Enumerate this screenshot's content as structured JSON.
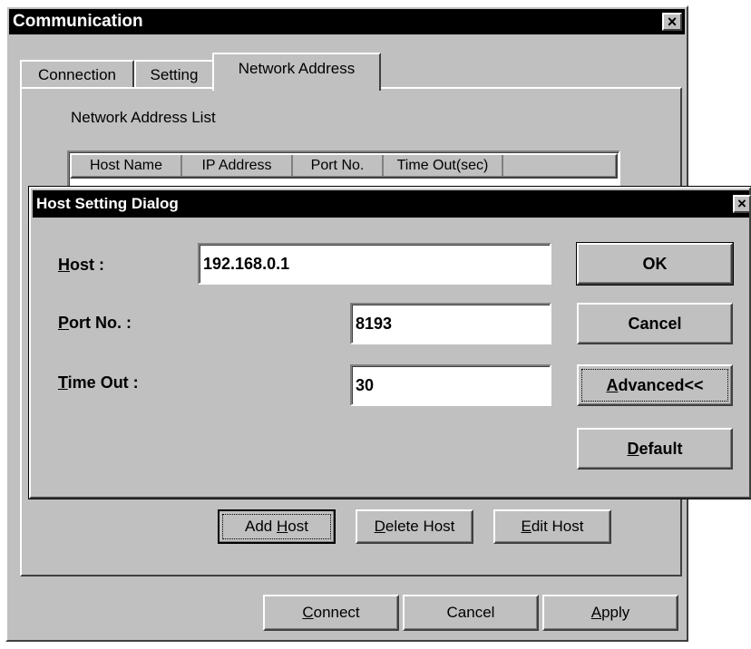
{
  "comm": {
    "title": "Communication",
    "close_glyph": "×",
    "tabs": [
      {
        "label": "Connection"
      },
      {
        "label": "Setting"
      },
      {
        "label": "Network Address"
      }
    ],
    "list_label": "Network Address List",
    "columns": [
      "Host Name",
      "IP Address",
      "Port No.",
      "Time Out(sec)"
    ],
    "add_host": {
      "pre": "Add ",
      "key": "H",
      "post": "ost"
    },
    "delete_host": {
      "pre": "",
      "key": "D",
      "post": "elete Host"
    },
    "edit_host": {
      "pre": "",
      "key": "E",
      "post": "dit Host"
    },
    "connect": {
      "pre": "",
      "key": "C",
      "post": "onnect"
    },
    "cancel": "Cancel",
    "apply": {
      "pre": "",
      "key": "A",
      "post": "pply"
    }
  },
  "host_dialog": {
    "title": "Host Setting Dialog",
    "close_glyph": "×",
    "host_label": {
      "key": "H",
      "post": "ost :"
    },
    "host_value": "192.168.0.1",
    "port_label": {
      "key": "P",
      "post": "ort No. :"
    },
    "port_value": "8193",
    "timeout_label": {
      "key": "T",
      "post": "ime Out :"
    },
    "timeout_value": "30",
    "ok": "OK",
    "cancel": "Cancel",
    "advanced": {
      "key": "A",
      "post": "dvanced<<"
    },
    "default": {
      "key": "D",
      "post": "efault"
    }
  }
}
